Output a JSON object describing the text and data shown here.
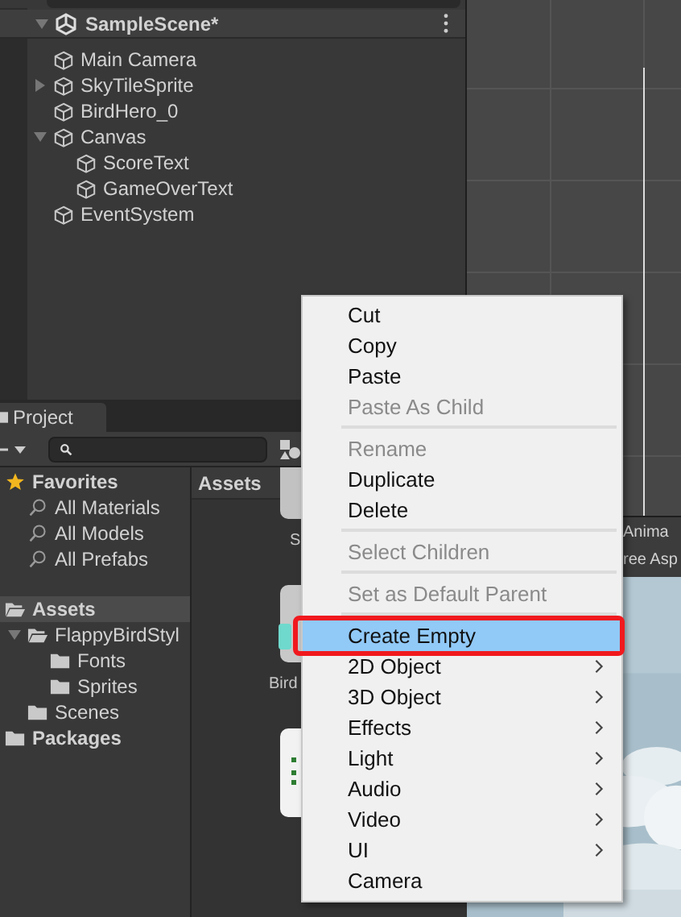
{
  "hierarchy": {
    "scene": {
      "label": "SampleScene*",
      "expanded": true,
      "children": [
        {
          "label": "Main Camera"
        },
        {
          "label": "SkyTileSprite",
          "expanded": false
        },
        {
          "label": "BirdHero_0"
        },
        {
          "label": "Canvas",
          "expanded": true,
          "children": [
            {
              "label": "ScoreText"
            },
            {
              "label": "GameOverText"
            }
          ]
        },
        {
          "label": "EventSystem"
        }
      ]
    }
  },
  "project": {
    "tab": "Project",
    "tree": [
      {
        "label": "Favorites",
        "kind": "favorites",
        "selected": false,
        "children": [
          {
            "label": "All Materials",
            "kind": "search",
            "selected": false
          },
          {
            "label": "All Models",
            "kind": "search",
            "selected": false
          },
          {
            "label": "All Prefabs",
            "kind": "search",
            "selected": false
          }
        ]
      },
      {
        "kind": "gap"
      },
      {
        "label": "Assets",
        "kind": "folder",
        "selected": true,
        "children": [
          {
            "label": "FlappyBirdStyl",
            "kind": "folder",
            "selected": false,
            "expanded": true,
            "children": [
              {
                "label": "Fonts",
                "kind": "folder",
                "selected": false
              },
              {
                "label": "Sprites",
                "kind": "folder",
                "selected": false
              }
            ]
          },
          {
            "label": "Scenes",
            "kind": "folder",
            "selected": false
          }
        ]
      },
      {
        "label": "Packages",
        "kind": "folder",
        "selected": false
      }
    ],
    "breadcrumb": "Assets",
    "assets": [
      {
        "label": "S",
        "kind": "scene"
      },
      {
        "label": "Bird",
        "kind": "prefab"
      },
      {
        "kind": "sprite"
      }
    ]
  },
  "game_view": {
    "lines": [
      "Anima",
      "ree Asp"
    ]
  },
  "context_menu": [
    {
      "kind": "item",
      "label": "Cut",
      "disabled": false,
      "selected": false,
      "submenu": false
    },
    {
      "kind": "item",
      "label": "Copy",
      "disabled": false,
      "selected": false,
      "submenu": false
    },
    {
      "kind": "item",
      "label": "Paste",
      "disabled": false,
      "selected": false,
      "submenu": false
    },
    {
      "kind": "item",
      "label": "Paste As Child",
      "disabled": true,
      "selected": false,
      "submenu": false
    },
    {
      "kind": "separator"
    },
    {
      "kind": "item",
      "label": "Rename",
      "disabled": true,
      "selected": false,
      "submenu": false
    },
    {
      "kind": "item",
      "label": "Duplicate",
      "disabled": false,
      "selected": false,
      "submenu": false
    },
    {
      "kind": "item",
      "label": "Delete",
      "disabled": false,
      "selected": false,
      "submenu": false
    },
    {
      "kind": "separator"
    },
    {
      "kind": "item",
      "label": "Select Children",
      "disabled": true,
      "selected": false,
      "submenu": false
    },
    {
      "kind": "separator"
    },
    {
      "kind": "item",
      "label": "Set as Default Parent",
      "disabled": true,
      "selected": false,
      "submenu": false
    },
    {
      "kind": "separator"
    },
    {
      "kind": "item",
      "label": "Create Empty",
      "disabled": false,
      "selected": true,
      "submenu": false
    },
    {
      "kind": "item",
      "label": "2D Object",
      "disabled": false,
      "selected": false,
      "submenu": true
    },
    {
      "kind": "item",
      "label": "3D Object",
      "disabled": false,
      "selected": false,
      "submenu": true
    },
    {
      "kind": "item",
      "label": "Effects",
      "disabled": false,
      "selected": false,
      "submenu": true
    },
    {
      "kind": "item",
      "label": "Light",
      "disabled": false,
      "selected": false,
      "submenu": true
    },
    {
      "kind": "item",
      "label": "Audio",
      "disabled": false,
      "selected": false,
      "submenu": true
    },
    {
      "kind": "item",
      "label": "Video",
      "disabled": false,
      "selected": false,
      "submenu": true
    },
    {
      "kind": "item",
      "label": "UI",
      "disabled": false,
      "selected": false,
      "submenu": true
    },
    {
      "kind": "item",
      "label": "Camera",
      "disabled": false,
      "selected": false,
      "submenu": false
    }
  ]
}
